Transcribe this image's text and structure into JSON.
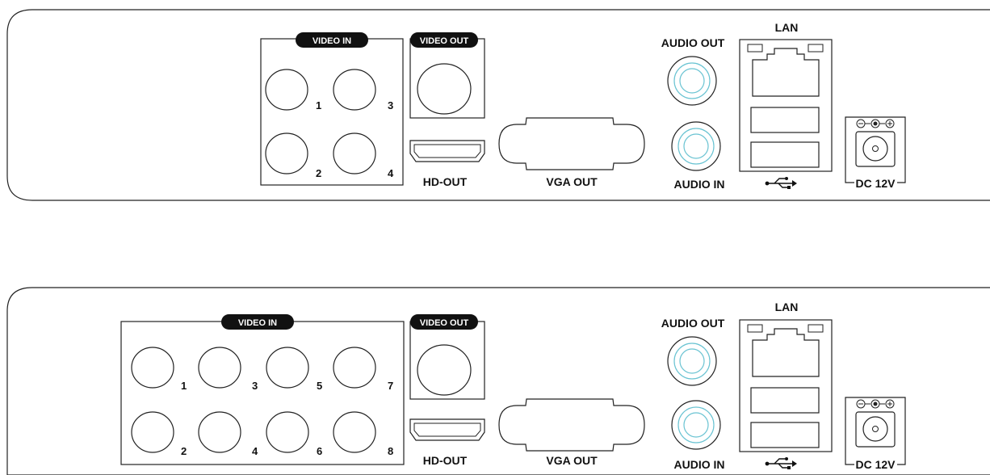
{
  "panels": [
    {
      "video_in_label": "VIDEO IN",
      "video_out_label": "VIDEO OUT",
      "video_in_numbers": [
        "1",
        "3",
        "2",
        "4"
      ],
      "hd_out_label": "HD-OUT",
      "vga_out_label": "VGA OUT",
      "audio_out_label": "AUDIO OUT",
      "audio_in_label": "AUDIO IN",
      "lan_label": "LAN",
      "dc_label": "DC 12V",
      "usb_icon": "usb-icon",
      "polarity_icon": "polarity-icon"
    },
    {
      "video_in_label": "VIDEO IN",
      "video_out_label": "VIDEO OUT",
      "video_in_numbers": [
        "1",
        "3",
        "5",
        "7",
        "2",
        "4",
        "6",
        "8"
      ],
      "hd_out_label": "HD-OUT",
      "vga_out_label": "VGA OUT",
      "audio_out_label": "AUDIO OUT",
      "audio_in_label": "AUDIO IN",
      "lan_label": "LAN",
      "dc_label": "DC 12V",
      "usb_icon": "usb-icon",
      "polarity_icon": "polarity-icon"
    }
  ],
  "colors": {
    "line": "#222222",
    "rca_ring": "#69c3d2",
    "pill": "#111111"
  }
}
